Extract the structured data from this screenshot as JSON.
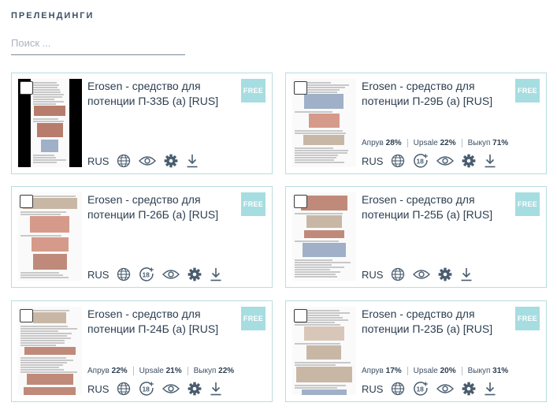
{
  "header": {
    "title": "ПРЕЛЕНДИНГИ"
  },
  "search": {
    "placeholder": "Поиск ..."
  },
  "cards": [
    {
      "title": "Erosen - средство для потенции П-33Б (а) [RUS]",
      "badge": "FREE",
      "lang": "RUS",
      "stats": null,
      "age18": false
    },
    {
      "title": "Erosen - средство для потенции П-29Б (а) [RUS]",
      "badge": "FREE",
      "lang": "RUS",
      "stats": [
        {
          "label": "Апрув",
          "value": "28%"
        },
        {
          "label": "Upsale",
          "value": "22%"
        },
        {
          "label": "Выкуп",
          "value": "71%"
        }
      ],
      "age18": true
    },
    {
      "title": "Erosen - средство для потенции П-26Б (а) [RUS]",
      "badge": "FREE",
      "lang": "RUS",
      "stats": null,
      "age18": true
    },
    {
      "title": "Erosen - средство для потенции П-25Б (а) [RUS]",
      "badge": "FREE",
      "lang": "RUS",
      "stats": null,
      "age18": false
    },
    {
      "title": "Erosen - средство для потенции П-24Б (а) [RUS]",
      "badge": "FREE",
      "lang": "RUS",
      "stats": [
        {
          "label": "Апрув",
          "value": "22%"
        },
        {
          "label": "Upsale",
          "value": "21%"
        },
        {
          "label": "Выкуп",
          "value": "22%"
        }
      ],
      "age18": true
    },
    {
      "title": "Erosen - средство для потенции П-23Б (а) [RUS]",
      "badge": "FREE",
      "lang": "RUS",
      "stats": [
        {
          "label": "Апрув",
          "value": "17%"
        },
        {
          "label": "Upsale",
          "value": "20%"
        },
        {
          "label": "Выкуп",
          "value": "31%"
        }
      ],
      "age18": true
    }
  ],
  "icons": {
    "globe": "globe-icon",
    "age": "age-18-plus-icon",
    "eye": "eye-icon",
    "gear": "gear-icon",
    "download": "download-icon"
  },
  "colors": {
    "card_border": "#b9dde0",
    "badge_bg": "#a6dde0",
    "icon": "#4a5d70",
    "text": "#2c3e50"
  }
}
